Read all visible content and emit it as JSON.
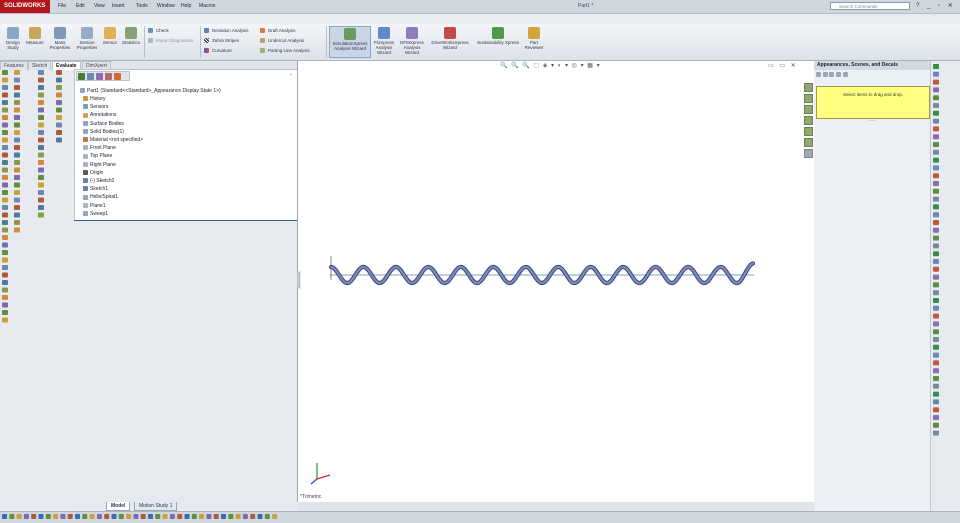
{
  "app": {
    "logo_text": "SOLIDWORKS",
    "document_title": "Part1 *",
    "menus": [
      "File",
      "Edit",
      "View",
      "Insert",
      "Tools",
      "Window",
      "Help",
      "Macros"
    ],
    "search_placeholder": "Search Commands",
    "window_controls": "? _ ▫ ✕"
  },
  "ribbon": {
    "buttons": [
      {
        "label": "Design Study"
      },
      {
        "label": "Measure"
      },
      {
        "label": "Mass Properties"
      },
      {
        "label": "Section Properties"
      },
      {
        "label": "Sensor"
      },
      {
        "label": "Statistics"
      }
    ],
    "small_group_1": [
      "Check",
      "Import Diagnostics"
    ],
    "small_group_2": [
      "Deviation Analysis",
      "Zebra Stripes",
      "Curvature"
    ],
    "small_group_3": [
      "Draft Analysis",
      "Undercut Analysis",
      "Parting Line Analysis"
    ],
    "wizards": [
      {
        "label": "SimulationXpress Analysis Wizard"
      },
      {
        "label": "FloXpress Analysis Wizard"
      },
      {
        "label": "DFMXpress Analysis Wizard"
      },
      {
        "label": "DriveWorksXpress Wizard"
      },
      {
        "label": "Sustainability Xpress"
      },
      {
        "label": "Part Reviewer"
      }
    ]
  },
  "manager_tabs": [
    "Features",
    "Sketch",
    "Evaluate",
    "DimXpert"
  ],
  "selected_tab": "Evaluate",
  "tree": {
    "root": "Part1  (Standard<<Standard>_Appearance Display State 1>)",
    "items": [
      "History",
      "Sensors",
      "Annotations",
      "Surface Bodies",
      "Solid Bodies(1)",
      "Material <not specified>",
      "Front Plane",
      "Top Plane",
      "Right Plane",
      "Origin",
      "(-) Sketch2",
      "Sketch1",
      "Helix/Spiral1",
      "Plane1",
      "Sweep1"
    ]
  },
  "graphics": {
    "view_label": "*Trimetric",
    "heads_up_toolbar": "🔍 🔍 🔍 ⬚ ◈ ▾ ◐ ▾ ◎ ▾ ▦ ▾",
    "window_buttons": "▭ ▭ ✕"
  },
  "task_pane": {
    "title": "Appearances, Scenes, and Decals",
    "hint": "Select items to drag and drop."
  },
  "bottom_tabs": [
    "Model",
    "Motion Study 1"
  ],
  "colors": {
    "accent": "#b3151b",
    "helix": "#5b6aa0",
    "hint_bg": "#ffff80"
  }
}
